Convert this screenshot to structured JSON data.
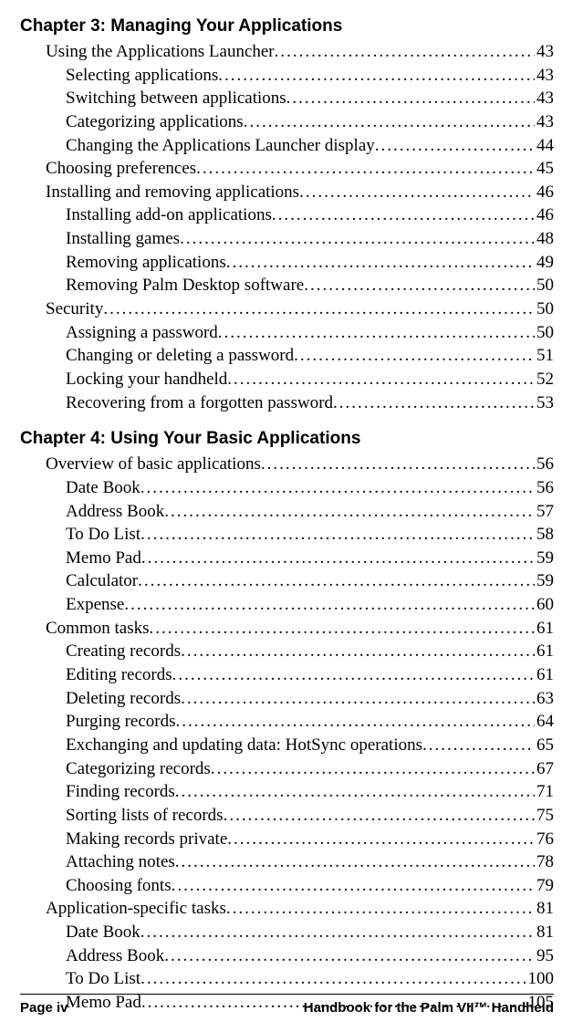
{
  "chapters": [
    {
      "title": "Chapter 3: Managing Your Applications",
      "entries": [
        {
          "indent": 1,
          "text": "Using the Applications Launcher",
          "page": "43"
        },
        {
          "indent": 2,
          "text": "Selecting applications",
          "page": "43"
        },
        {
          "indent": 2,
          "text": "Switching between applications",
          "page": "43"
        },
        {
          "indent": 2,
          "text": "Categorizing applications",
          "page": "43"
        },
        {
          "indent": 2,
          "text": "Changing the Applications Launcher display",
          "page": "44"
        },
        {
          "indent": 1,
          "text": "Choosing preferences",
          "page": "45"
        },
        {
          "indent": 1,
          "text": "Installing and removing applications",
          "page": "46"
        },
        {
          "indent": 2,
          "text": "Installing add-on applications",
          "page": "46"
        },
        {
          "indent": 2,
          "text": "Installing games",
          "page": "48"
        },
        {
          "indent": 2,
          "text": "Removing applications",
          "page": "49"
        },
        {
          "indent": 2,
          "text": "Removing Palm Desktop software",
          "page": "50"
        },
        {
          "indent": 1,
          "text": "Security",
          "page": "50"
        },
        {
          "indent": 2,
          "text": "Assigning a password",
          "page": "50"
        },
        {
          "indent": 2,
          "text": "Changing or deleting a password",
          "page": "51"
        },
        {
          "indent": 2,
          "text": "Locking your handheld",
          "page": "52"
        },
        {
          "indent": 2,
          "text": "Recovering from a forgotten password",
          "page": "53"
        }
      ]
    },
    {
      "title": "Chapter 4: Using Your Basic Applications",
      "entries": [
        {
          "indent": 1,
          "text": "Overview of basic applications",
          "page": "56"
        },
        {
          "indent": 2,
          "text": "Date Book",
          "page": "56"
        },
        {
          "indent": 2,
          "text": "Address Book",
          "page": "57"
        },
        {
          "indent": 2,
          "text": "To Do List",
          "page": "58"
        },
        {
          "indent": 2,
          "text": "Memo Pad",
          "page": "59"
        },
        {
          "indent": 2,
          "text": "Calculator",
          "page": "59"
        },
        {
          "indent": 2,
          "text": "Expense",
          "page": "60"
        },
        {
          "indent": 1,
          "text": "Common tasks",
          "page": "61"
        },
        {
          "indent": 2,
          "text": "Creating records",
          "page": "61"
        },
        {
          "indent": 2,
          "text": "Editing records",
          "page": "61"
        },
        {
          "indent": 2,
          "text": "Deleting records",
          "page": "63"
        },
        {
          "indent": 2,
          "text": "Purging records",
          "page": "64"
        },
        {
          "indent": 2,
          "text": "Exchanging and updating data: HotSync operations",
          "page": "65"
        },
        {
          "indent": 2,
          "text": "Categorizing records",
          "page": "67"
        },
        {
          "indent": 2,
          "text": "Finding records",
          "page": "71"
        },
        {
          "indent": 2,
          "text": "Sorting lists of records",
          "page": "75"
        },
        {
          "indent": 2,
          "text": "Making records private",
          "page": "76"
        },
        {
          "indent": 2,
          "text": "Attaching notes",
          "page": "78"
        },
        {
          "indent": 2,
          "text": "Choosing fonts",
          "page": "79"
        },
        {
          "indent": 1,
          "text": "Application-specific tasks",
          "page": "81"
        },
        {
          "indent": 2,
          "text": "Date Book",
          "page": "81"
        },
        {
          "indent": 2,
          "text": "Address Book",
          "page": "95"
        },
        {
          "indent": 2,
          "text": "To Do List",
          "page": "100"
        },
        {
          "indent": 2,
          "text": "Memo Pad",
          "page": "105"
        }
      ]
    }
  ],
  "footer": {
    "left": "Page iv",
    "right": "Handbook for the Palm VII™ Handheld"
  }
}
